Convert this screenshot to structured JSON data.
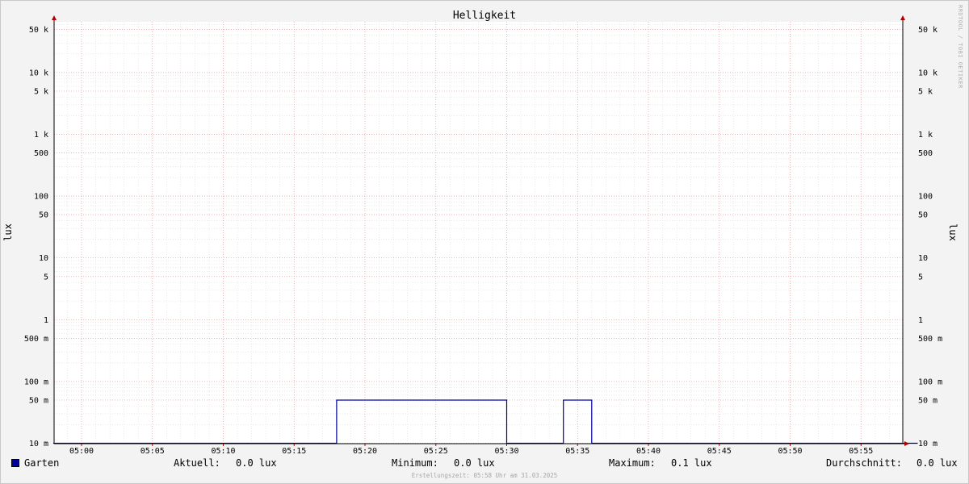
{
  "chart_data": {
    "type": "line",
    "title": "Helligkeit",
    "ylabel": "lux",
    "y_scale": "log",
    "ylim": [
      0.01,
      80000
    ],
    "xlim": [
      "04:58",
      "05:59"
    ],
    "y_ticks": [
      {
        "value": 0.01,
        "label": "10 m"
      },
      {
        "value": 0.05,
        "label": "50 m"
      },
      {
        "value": 0.1,
        "label": "100 m"
      },
      {
        "value": 0.5,
        "label": "500 m"
      },
      {
        "value": 1,
        "label": "1"
      },
      {
        "value": 5,
        "label": "5"
      },
      {
        "value": 10,
        "label": "10"
      },
      {
        "value": 50,
        "label": "50"
      },
      {
        "value": 100,
        "label": "100"
      },
      {
        "value": 500,
        "label": "500"
      },
      {
        "value": 1000,
        "label": "1 k"
      },
      {
        "value": 5000,
        "label": "5 k"
      },
      {
        "value": 10000,
        "label": "10 k"
      },
      {
        "value": 50000,
        "label": "50 k"
      }
    ],
    "x_ticks": [
      "05:00",
      "05:05",
      "05:10",
      "05:15",
      "05:20",
      "05:25",
      "05:30",
      "05:35",
      "05:40",
      "05:45",
      "05:50",
      "05:55"
    ],
    "grid": true,
    "series": [
      {
        "name": "Garten",
        "color": "#00009a",
        "x": [
          "04:58",
          "05:18",
          "05:18",
          "05:30",
          "05:30",
          "05:34",
          "05:34",
          "05:36",
          "05:36",
          "05:59"
        ],
        "y": [
          0.01,
          0.01,
          0.05,
          0.05,
          0.01,
          0.01,
          0.05,
          0.05,
          0.01,
          0.01
        ]
      }
    ]
  },
  "watermark": "RRDTOOL / TOBI OETIKER",
  "legend": {
    "series_name": "Garten",
    "current_label": "Aktuell:",
    "current_value": "0.0 lux",
    "min_label": "Minimum:",
    "min_value": "0.0 lux",
    "max_label": "Maximum:",
    "max_value": "0.1 lux",
    "avg_label": "Durchschnitt:",
    "avg_value": "0.0 lux"
  },
  "footer": "Erstellungszeit: 05:58 Uhr am 31.03.2025"
}
